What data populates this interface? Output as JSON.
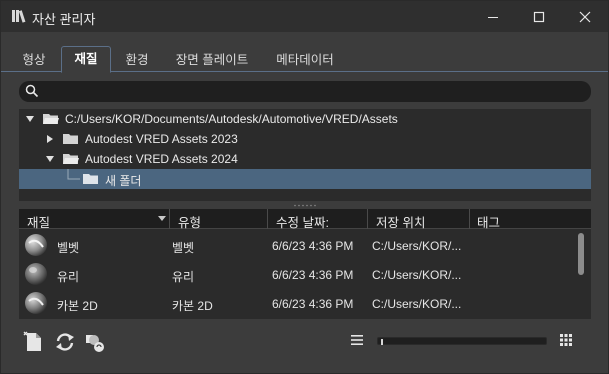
{
  "window": {
    "title": "자산 관리자",
    "app_icon": "books-icon",
    "controls": [
      "minimize-icon",
      "maximize-icon",
      "close-icon"
    ]
  },
  "tabs": [
    {
      "label": "형상",
      "active": false
    },
    {
      "label": "재질",
      "active": true
    },
    {
      "label": "환경",
      "active": false
    },
    {
      "label": "장면 플레이트",
      "active": false
    },
    {
      "label": "메타데이터",
      "active": false
    }
  ],
  "search": {
    "value": "",
    "placeholder": ""
  },
  "tree": {
    "root": "C:/Users/KOR/Documents/Autodesk/Automotive/VRED/Assets",
    "items": [
      {
        "label": "Autodest VRED Assets 2023",
        "expanded": false
      },
      {
        "label": "Autodest VRED Assets 2024",
        "expanded": true
      },
      {
        "label": "새 폴더",
        "selected": true
      }
    ]
  },
  "table": {
    "headers": {
      "material": "재질",
      "type": "유형",
      "modified": "수정 날짜:",
      "location": "저장 위치",
      "tags": "태그"
    },
    "rows": [
      {
        "name": "벨벳",
        "type": "벨벳",
        "modified": "6/6/23 4:36 PM",
        "location": "C:/Users/KOR/...",
        "tags": ""
      },
      {
        "name": "유리",
        "type": "유리",
        "modified": "6/6/23 4:36 PM",
        "location": "C:/Users/KOR/...",
        "tags": ""
      },
      {
        "name": "카본 2D",
        "type": "카본 2D",
        "modified": "6/6/23 4:36 PM",
        "location": "C:/Users/KOR/...",
        "tags": ""
      }
    ]
  },
  "toolbar": {
    "left_icons": [
      "new-document-icon",
      "refresh-icon",
      "material-sync-icon"
    ],
    "right_icons": [
      "list-view-icon",
      "grid-view-icon"
    ],
    "zoom_level": 0.02
  },
  "colors": {
    "selection": "#4b6680",
    "accent_border": "#5b6f88",
    "background": "#3c3c3c",
    "panel": "#2b2b2b"
  }
}
